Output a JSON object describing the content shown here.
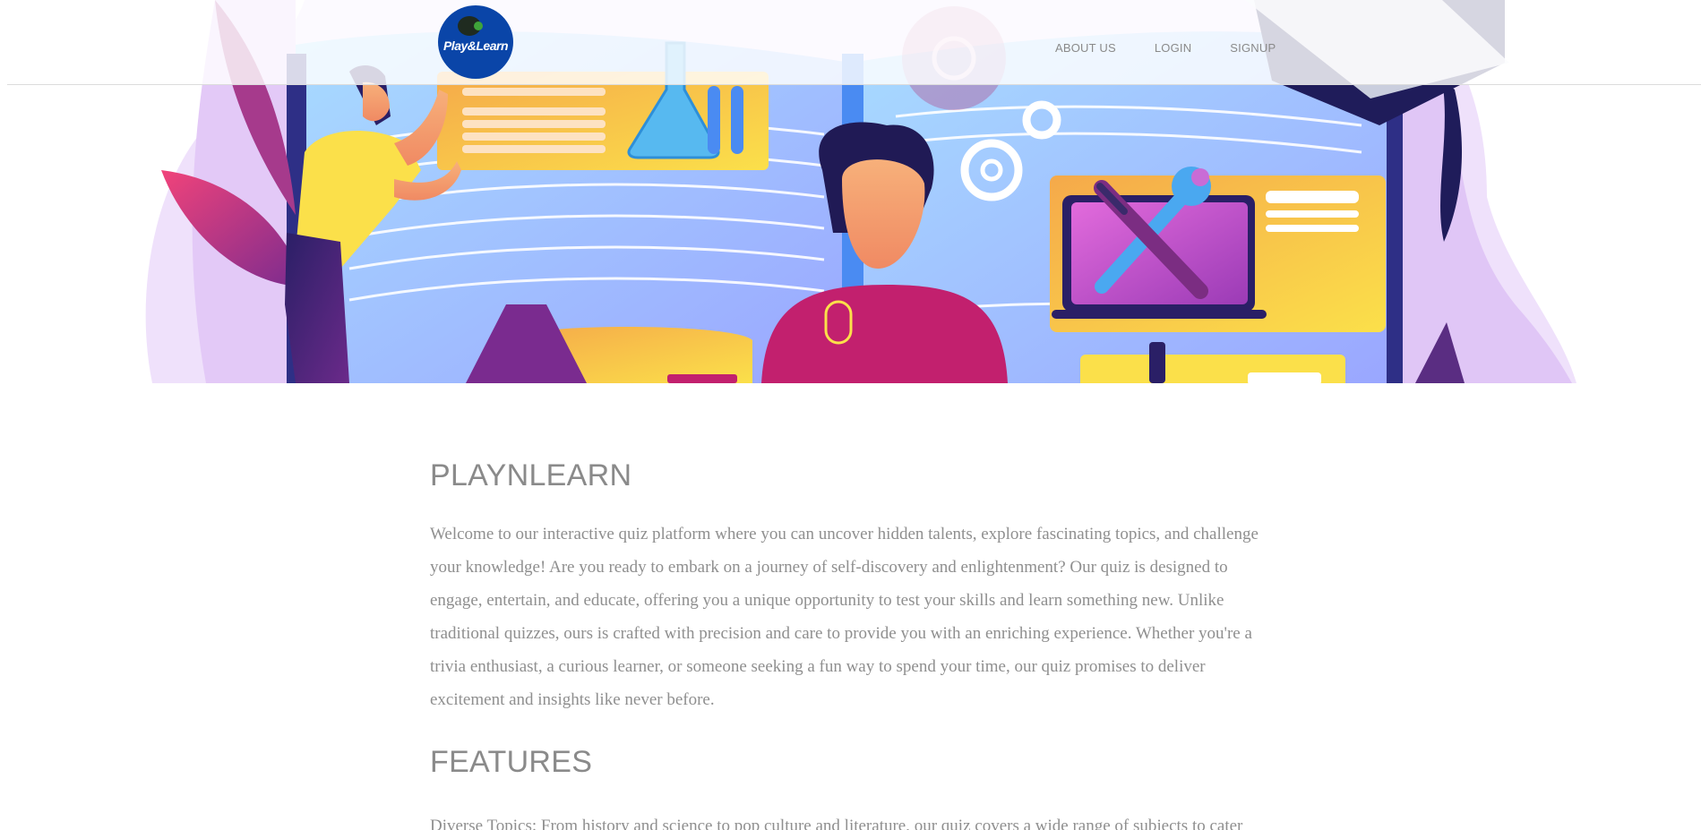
{
  "navbar": {
    "logo_text": "Play&Learn",
    "links": [
      "ABOUT US",
      "LOGIN",
      "SIGNUP"
    ]
  },
  "main": {
    "heading": "PLAYNLEARN",
    "intro": "Welcome to our interactive quiz platform where you can uncover hidden talents, explore fascinating topics, and challenge your knowledge! Are you ready to embark on a journey of self-discovery and enlightenment? Our quiz is designed to engage, entertain, and educate, offering you a unique opportunity to test your skills and learn something new. Unlike traditional quizzes, ours is crafted with precision and care to provide you with an enriching experience. Whether you're a trivia enthusiast, a curious learner, or someone seeking a fun way to spend your time, our quiz promises to deliver excitement and insights like never before.",
    "features_heading": "FEATURES",
    "features_text": "Diverse Topics: From history and science to pop culture and literature, our quiz covers a wide range of subjects to cater"
  },
  "colors": {
    "accent_blue": "#0a45a8",
    "text_gray": "#8a8a8a",
    "hero_purple": "#5a2d82",
    "hero_yellow": "#f7c843",
    "hero_pink": "#c2206e"
  },
  "icons": [
    "logo-icon",
    "flask-icon",
    "gear-icon",
    "wrench-icon",
    "screwdriver-icon",
    "laptop-icon",
    "graduation-cap-icon"
  ]
}
